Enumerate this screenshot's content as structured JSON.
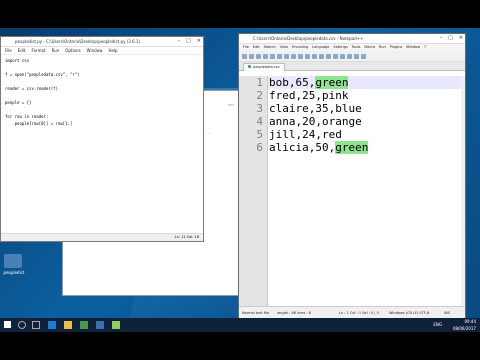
{
  "idle": {
    "title": "peopledict.py - C:\\Users\\Ontario\\Desktop\\peopledict.py (3.6.1)",
    "menu": [
      "File",
      "Edit",
      "Format",
      "Run",
      "Options",
      "Window",
      "Help"
    ],
    "code": [
      "import csv",
      "",
      "f = open(\"peopledata.csv\", \"r\")",
      "",
      "reader = csv.reader(f)",
      "",
      "people = {}",
      "",
      "for row in reader:",
      "    people[row[0]] = row[1:]"
    ],
    "status": "Ln: 11  Col: 16"
  },
  "npp": {
    "title": "C:\\Users\\Ontario\\Desktop\\peopledata.csv - Notepad++",
    "menu": [
      "File",
      "Edit",
      "Search",
      "View",
      "Encoding",
      "Language",
      "Settings",
      "Tools",
      "Macro",
      "Run",
      "Plugins",
      "Window",
      "?"
    ],
    "tab": "peopledata.csv",
    "lines": [
      {
        "num": "1",
        "text": "bob,65,",
        "hl": "green"
      },
      {
        "num": "2",
        "text": "fred,25,pink",
        "hl": ""
      },
      {
        "num": "3",
        "text": "claire,35,blue",
        "hl": ""
      },
      {
        "num": "4",
        "text": "anna,20,orange",
        "hl": ""
      },
      {
        "num": "5",
        "text": "jill,24,red",
        "hl": ""
      },
      {
        "num": "6",
        "text": "alicia,50,",
        "hl": "green"
      }
    ],
    "status": {
      "type": "Normal text file",
      "length": "length : 86    lines : 6",
      "pos": "Ln : 1    Col : 1    Sel : 0 | 0",
      "eol": "Windows (CR LF)",
      "enc": "UTF-8",
      "ins": "INS"
    }
  },
  "desktop_icon_label": "peopledict",
  "tray": {
    "time": "09:44",
    "date": "08/06/2017",
    "lang": "ENG"
  },
  "colors": {
    "highlight": "#8fe38f",
    "taskbar": "#10223a"
  }
}
